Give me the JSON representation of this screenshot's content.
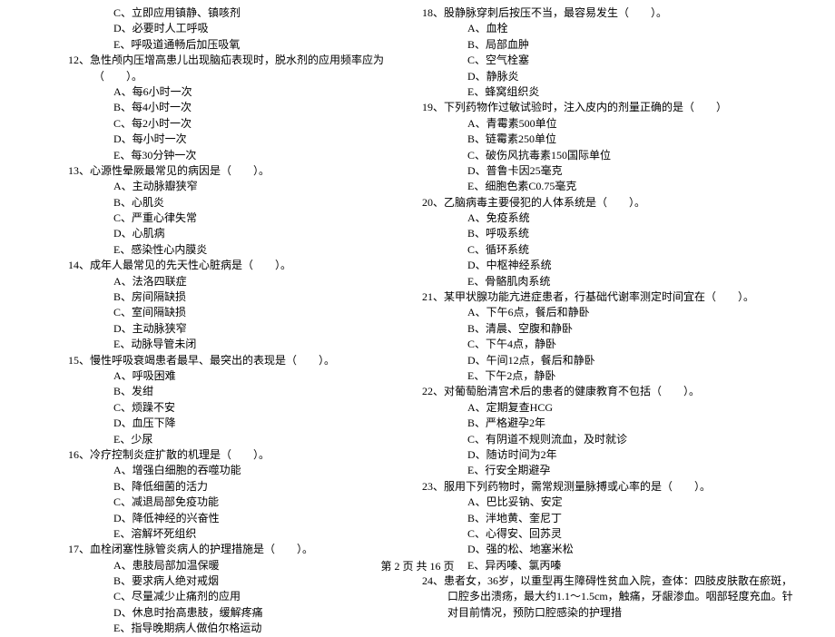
{
  "footer": "第 2 页 共 16 页",
  "left": {
    "pre_opts": [
      "C、立即应用镇静、镇咳剂",
      "D、必要时人工呼吸",
      "E、呼吸道通畅后加压吸氧"
    ],
    "questions": [
      {
        "num": "12、",
        "stem": "急性颅内压增高患儿出现脑疝表现时，脱水剂的应用频率应为（　　）。",
        "opts": [
          "A、每6小时一次",
          "B、每4小时一次",
          "C、每2小时一次",
          "D、每小时一次",
          "E、每30分钟一次"
        ]
      },
      {
        "num": "13、",
        "stem": "心源性晕厥最常见的病因是（　　）。",
        "opts": [
          "A、主动脉瓣狭窄",
          "B、心肌炎",
          "C、严重心律失常",
          "D、心肌病",
          "E、感染性心内膜炎"
        ]
      },
      {
        "num": "14、",
        "stem": "成年人最常见的先天性心脏病是（　　）。",
        "opts": [
          "A、法洛四联症",
          "B、房间隔缺损",
          "C、室间隔缺损",
          "D、主动脉狭窄",
          "E、动脉导管未闭"
        ]
      },
      {
        "num": "15、",
        "stem": "慢性呼吸衰竭患者最早、最突出的表现是（　　）。",
        "opts": [
          "A、呼吸困难",
          "B、发绀",
          "C、烦躁不安",
          "D、血压下降",
          "E、少尿"
        ]
      },
      {
        "num": "16、",
        "stem": "冷疗控制炎症扩散的机理是（　　）。",
        "opts": [
          "A、增强白细胞的吞噬功能",
          "B、降低细菌的活力",
          "C、减退局部免疫功能",
          "D、降低神经的兴奋性",
          "E、溶解坏死组织"
        ]
      },
      {
        "num": "17、",
        "stem": "血栓闭塞性脉管炎病人的护理措施是（　　）。",
        "opts": [
          "A、患肢局部加温保暖",
          "B、要求病人绝对戒烟",
          "C、尽量减少止痛剂的应用",
          "D、休息时抬高患肢，缓解疼痛",
          "E、指导晚期病人做伯尔格运动"
        ]
      }
    ]
  },
  "right": {
    "questions": [
      {
        "num": "18、",
        "stem": "股静脉穿刺后按压不当，最容易发生（　　）。",
        "opts": [
          "A、血栓",
          "B、局部血肿",
          "C、空气栓塞",
          "D、静脉炎",
          "E、蜂窝组织炎"
        ]
      },
      {
        "num": "19、",
        "stem": "下列药物作过敏试验时，注入皮内的剂量正确的是（　　）",
        "opts": [
          "A、青霉素500单位",
          "B、链霉素250单位",
          "C、破伤风抗毒素150国际单位",
          "D、普鲁卡因25毫克",
          "E、细胞色素C0.75毫克"
        ]
      },
      {
        "num": "20、",
        "stem": "乙脑病毒主要侵犯的人体系统是（　　）。",
        "opts": [
          "A、免疫系统",
          "B、呼吸系统",
          "C、循环系统",
          "D、中枢神经系统",
          "E、骨骼肌肉系统"
        ]
      },
      {
        "num": "21、",
        "stem": "某甲状腺功能亢进症患者，行基础代谢率测定时间宜在（　　）。",
        "opts": [
          "A、下午6点，餐后和静卧",
          "B、清晨、空腹和静卧",
          "C、下午4点，静卧",
          "D、午间12点，餐后和静卧",
          "E、下午2点，静卧"
        ]
      },
      {
        "num": "22、",
        "stem": "对葡萄胎清宫术后的患者的健康教育不包括（　　）。",
        "opts": [
          "A、定期复查HCG",
          "B、严格避孕2年",
          "C、有阴道不规则流血，及时就诊",
          "D、随访时间为2年",
          "E、行安全期避孕"
        ]
      },
      {
        "num": "23、",
        "stem": "服用下列药物时，需常规测量脉搏或心率的是（　　）。",
        "opts": [
          "A、巴比妥钠、安定",
          "B、泮地黄、奎尼丁",
          "C、心得安、回苏灵",
          "D、强的松、地塞米松",
          "E、异丙嗪、氯丙嗪"
        ]
      },
      {
        "num": "24、",
        "stem": "患者女，36岁，以重型再生障碍性贫血入院，查体：四肢皮肤散在瘀斑，口腔多出溃疡，最大约1.1～1.5cm，触痛，牙龈渗血。咽部轻度充血。针对目前情况，预防口腔感染的护理措"
      }
    ]
  }
}
